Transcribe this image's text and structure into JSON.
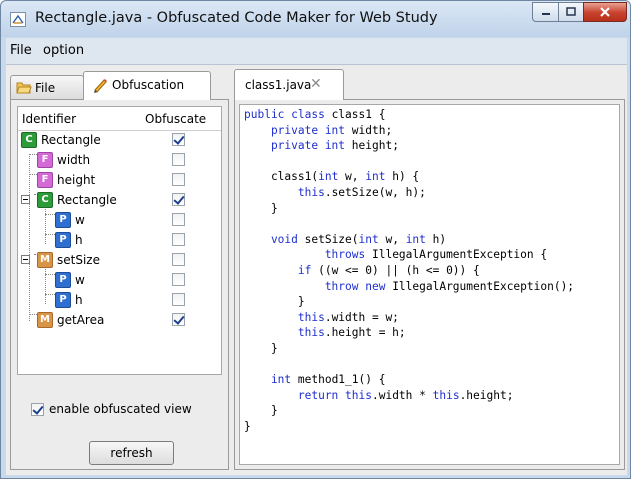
{
  "window": {
    "title": "Rectangle.java - Obfuscated Code Maker for Web Study"
  },
  "menu": [
    "File",
    "option"
  ],
  "left_tabs": [
    {
      "label": "File",
      "icon": "folder-icon",
      "selected": false
    },
    {
      "label": "Obfuscation",
      "icon": "pencil-icon",
      "selected": true
    }
  ],
  "tree": {
    "headers": {
      "identifier": "Identifier",
      "obfuscate": "Obfuscate"
    },
    "rows": [
      {
        "type": "C",
        "label": "Rectangle",
        "checked": true
      },
      {
        "type": "F",
        "label": "width",
        "checked": false
      },
      {
        "type": "F",
        "label": "height",
        "checked": false
      },
      {
        "type": "C",
        "label": "Rectangle",
        "checked": true
      },
      {
        "type": "P",
        "label": "w",
        "checked": false
      },
      {
        "type": "P",
        "label": "h",
        "checked": false
      },
      {
        "type": "M",
        "label": "setSize",
        "checked": false
      },
      {
        "type": "P",
        "label": "w",
        "checked": false
      },
      {
        "type": "P",
        "label": "h",
        "checked": false
      },
      {
        "type": "M",
        "label": "getArea",
        "checked": true
      }
    ]
  },
  "enable_view": {
    "label": "enable obfuscated view",
    "checked": true
  },
  "refresh_label": "refresh",
  "editor": {
    "tab_label": "class1.java",
    "code": [
      [
        [
          "kw",
          "public class "
        ],
        [
          "",
          "class1 {"
        ]
      ],
      [
        [
          "kw",
          "    private int "
        ],
        [
          "",
          "width;"
        ]
      ],
      [
        [
          "kw",
          "    private int "
        ],
        [
          "",
          "height;"
        ]
      ],
      [
        [
          "",
          ""
        ]
      ],
      [
        [
          "",
          "    class1("
        ],
        [
          "kw",
          "int "
        ],
        [
          "",
          "w, "
        ],
        [
          "kw",
          "int "
        ],
        [
          "",
          "h) {"
        ]
      ],
      [
        [
          "kw",
          "        this"
        ],
        [
          "",
          ".setSize(w, h);"
        ]
      ],
      [
        [
          "",
          "    }"
        ]
      ],
      [
        [
          "",
          ""
        ]
      ],
      [
        [
          "kw",
          "    void "
        ],
        [
          "",
          "setSize("
        ],
        [
          "kw",
          "int "
        ],
        [
          "",
          "w, "
        ],
        [
          "kw",
          "int "
        ],
        [
          "",
          "h)"
        ]
      ],
      [
        [
          "kw",
          "            throws "
        ],
        [
          "",
          "IllegalArgumentException {"
        ]
      ],
      [
        [
          "kw",
          "        if "
        ],
        [
          "",
          "((w <= 0) || (h <= 0)) {"
        ]
      ],
      [
        [
          "kw",
          "            throw new "
        ],
        [
          "",
          "IllegalArgumentException();"
        ]
      ],
      [
        [
          "",
          "        }"
        ]
      ],
      [
        [
          "kw",
          "        this"
        ],
        [
          "",
          ".width = w;"
        ]
      ],
      [
        [
          "kw",
          "        this"
        ],
        [
          "",
          ".height = h;"
        ]
      ],
      [
        [
          "",
          "    }"
        ]
      ],
      [
        [
          "",
          ""
        ]
      ],
      [
        [
          "kw",
          "    int "
        ],
        [
          "",
          "method1_1() {"
        ]
      ],
      [
        [
          "kw",
          "        return this"
        ],
        [
          "",
          ".width * "
        ],
        [
          "kw",
          "this"
        ],
        [
          "",
          ".height;"
        ]
      ],
      [
        [
          "",
          "    }"
        ]
      ],
      [
        [
          "",
          "}"
        ]
      ]
    ]
  },
  "colors": {
    "keyword": "#1e2fcf",
    "class": "#2d9b3a",
    "field": "#d36ad6",
    "param": "#2e6fd1",
    "method": "#d89447"
  }
}
